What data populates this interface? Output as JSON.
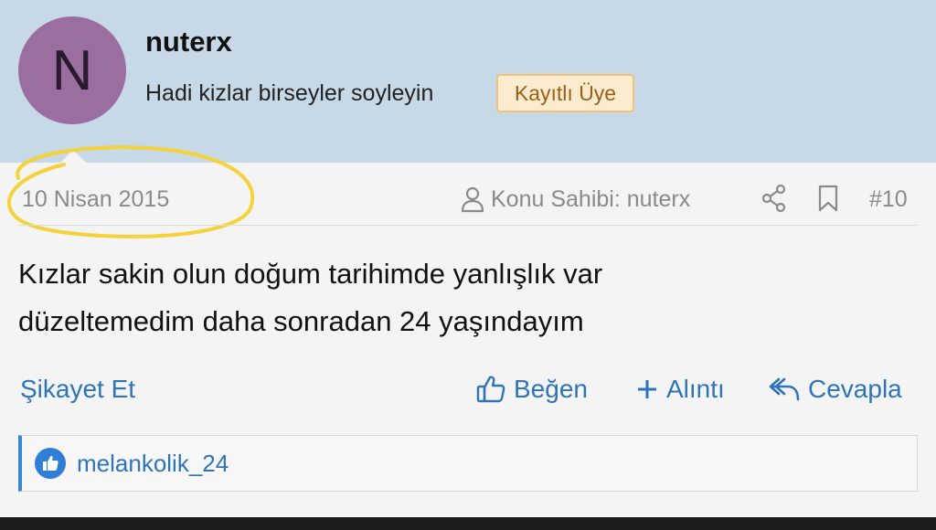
{
  "user": {
    "avatar_letter": "N",
    "name": "nuterx",
    "title": "Hadi kizlar birseyler soyleyin",
    "badge": "Kayıtlı Üye"
  },
  "meta": {
    "date": "10 Nisan 2015",
    "owner_label": "Konu Sahibi: nuterx",
    "post_number": "#10"
  },
  "post": {
    "lines": [
      "Kızlar sakin olun doğum tarihimde yanlışlık var",
      "düzeltemedim daha sonradan 24 yaşındayım"
    ]
  },
  "actions": {
    "report": "Şikayet Et",
    "like": "Beğen",
    "quote": "Alıntı",
    "reply": "Cevapla"
  },
  "reactions": {
    "user": "melankolik_24"
  },
  "colors": {
    "header_bg": "#c7d8e6",
    "avatar_bg": "#9a6f9f",
    "badge_bg": "#fbecd0",
    "badge_border": "#f0c27a",
    "badge_text": "#9b5f15",
    "link": "#2e74b7",
    "muted": "#8a8a8a",
    "highlight": "#f3d23a"
  },
  "icons": [
    "user-icon",
    "share-icon",
    "bookmark-icon",
    "thumbs-up-icon",
    "plus-icon",
    "reply-icon",
    "like-reaction-icon"
  ]
}
